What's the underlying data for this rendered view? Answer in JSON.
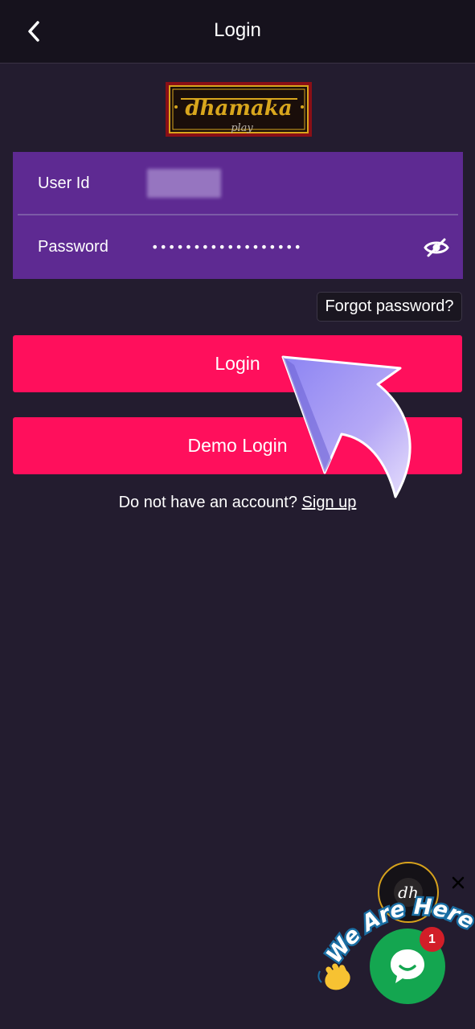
{
  "header": {
    "title": "Login",
    "back_icon": "chevron-left-icon"
  },
  "logo": {
    "text_main": "dhamaka",
    "text_sub": "play"
  },
  "form": {
    "userid_label": "User Id",
    "userid_value": "",
    "password_label": "Password",
    "password_value": "••••••••••••••••••",
    "eye_icon": "eye-off-icon"
  },
  "forgot_label": "Forgot password?",
  "login_label": "Login",
  "demo_login_label": "Demo Login",
  "signup": {
    "prompt": "Do not have an account?",
    "link": "Sign up"
  },
  "chat": {
    "banner_text": "We Are Here!",
    "badge_count": "1",
    "chat_icon": "chat-bubble-icon",
    "close_icon": "close-icon",
    "wave_icon": "waving-hand-icon"
  },
  "colors": {
    "background": "#231c2f",
    "header_bg": "#16121d",
    "form_bg": "#5e2a92",
    "primary": "#ff0f5c",
    "chat_green": "#14a650",
    "logo_gold": "#d8a61d",
    "logo_red": "#8a0f16"
  }
}
